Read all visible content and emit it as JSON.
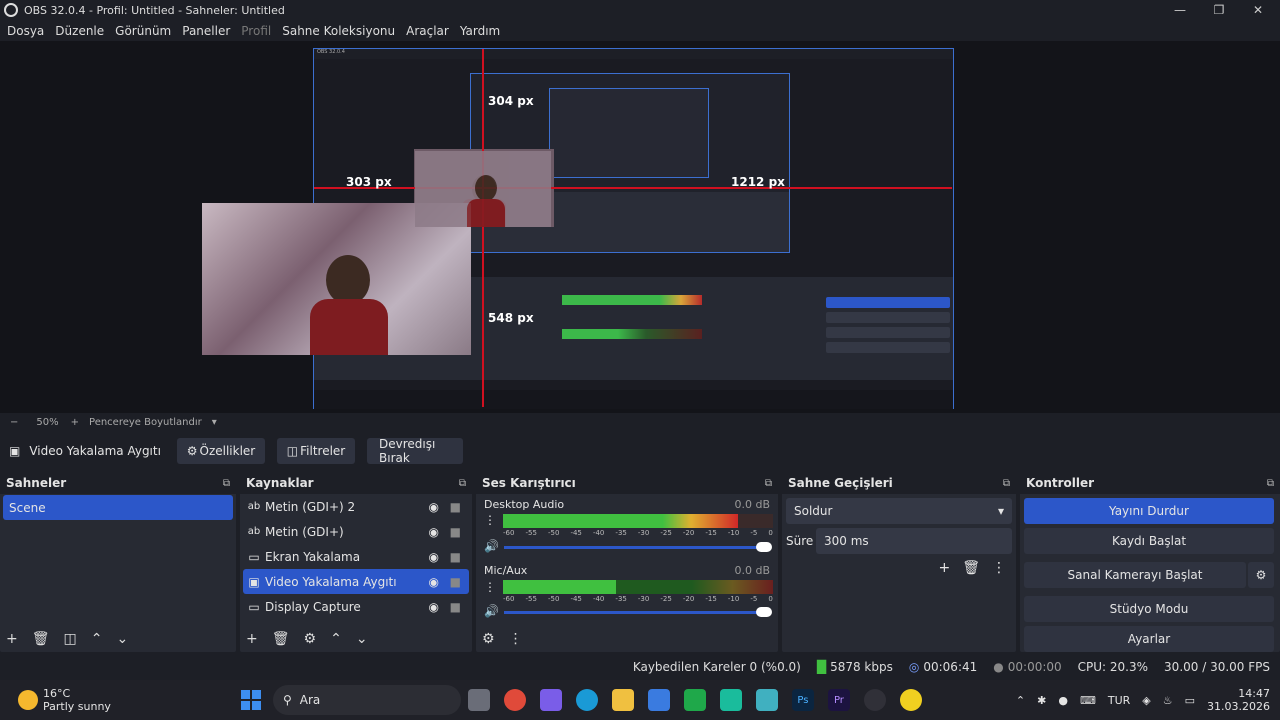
{
  "window": {
    "title": "OBS 32.0.4 - Profil: Untitled - Sahneler: Untitled"
  },
  "menu": {
    "items": [
      "Dosya",
      "Düzenle",
      "Görünüm",
      "Paneller",
      "Profil",
      "Sahne Koleksiyonu",
      "Araçlar",
      "Yardım"
    ]
  },
  "preview": {
    "labels": [
      "304 px",
      "303 px",
      "1212 px",
      "548 px"
    ]
  },
  "zoom": {
    "minus": "−",
    "value": "50%",
    "plus": "+",
    "fit": "Pencereye Boyutlandır"
  },
  "source_toolbar": {
    "current": "Video Yakalama Aygıtı",
    "properties": "Özellikler",
    "filters": "Filtreler",
    "deactivate": "Devredışı Bırak"
  },
  "scenes": {
    "title": "Sahneler",
    "items": [
      "Scene"
    ]
  },
  "sources": {
    "title": "Kaynaklar",
    "items": [
      {
        "name": "Metin (GDI+) 2",
        "icon": "text-icon"
      },
      {
        "name": "Metin (GDI+)",
        "icon": "text-icon"
      },
      {
        "name": "Ekran Yakalama",
        "icon": "monitor-icon"
      },
      {
        "name": "Video Yakalama Aygıtı",
        "icon": "camera-icon"
      },
      {
        "name": "Display Capture",
        "icon": "monitor-icon"
      }
    ]
  },
  "mixer": {
    "title": "Ses Karıştırıcı",
    "channels": [
      {
        "name": "Desktop Audio",
        "db": "0.0 dB",
        "level": 0.87
      },
      {
        "name": "Mic/Aux",
        "db": "0.0 dB",
        "level": 0.42
      }
    ],
    "ticks": [
      "-60",
      "-55",
      "-50",
      "-45",
      "-40",
      "-35",
      "-30",
      "-25",
      "-20",
      "-15",
      "-10",
      "-5",
      "0"
    ]
  },
  "transitions": {
    "title": "Sahne Geçişleri",
    "type": "Soldur",
    "duration_label": "Süre",
    "duration": "300 ms"
  },
  "controls": {
    "title": "Kontroller",
    "buttons": [
      "Yayını Durdur",
      "Kaydı Başlat",
      "Sanal Kamerayı Başlat",
      "Stüdyo Modu",
      "Ayarlar"
    ]
  },
  "status": {
    "dropped": "Kaybedilen Kareler 0 (%0.0)",
    "bitrate": "5878 kbps",
    "stream_time": "00:06:41",
    "rec_time": "00:00:00",
    "cpu": "CPU: 20.3%",
    "fps": "30.00 / 30.00 FPS"
  },
  "taskbar": {
    "temp": "16°C",
    "weather": "Partly sunny",
    "search": "Ara",
    "lang": "TUR",
    "time": "14:47",
    "date": "31.03.2026"
  },
  "colors": {
    "accent": "#2c57c9",
    "bg": "#1d1f26",
    "panel": "#272a33"
  }
}
